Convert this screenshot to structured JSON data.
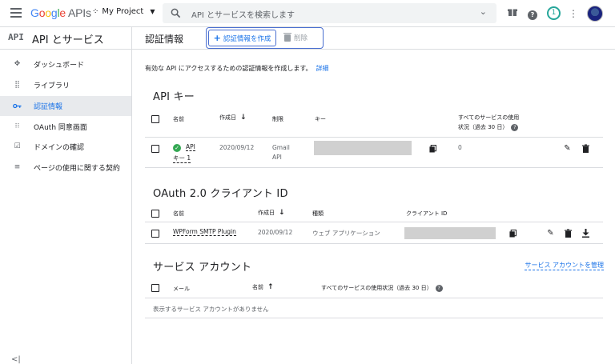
{
  "header": {
    "logo": [
      "G",
      "o",
      "o",
      "g",
      "l",
      "e"
    ],
    "logo_suffix": "APIs",
    "project_name": "My Project",
    "search_placeholder": "API とサービスを検索します",
    "notification_count": "1"
  },
  "sidebar": {
    "section_badge": "API",
    "title": "API とサービス",
    "items": [
      {
        "label": "ダッシュボード",
        "icon": "dashboard-icon"
      },
      {
        "label": "ライブラリ",
        "icon": "library-icon"
      },
      {
        "label": "認証情報",
        "icon": "key-icon",
        "active": true
      },
      {
        "label": "OAuth 同意画面",
        "icon": "oauth-icon"
      },
      {
        "label": "ドメインの確認",
        "icon": "domain-check-icon"
      },
      {
        "label": "ページの使用に関する契約",
        "icon": "settings-list-icon"
      }
    ],
    "collapse_label": "<|"
  },
  "page": {
    "title": "認証情報",
    "create_button": "認証情報を作成",
    "delete_button": "削除",
    "intro_text": "有効な API にアクセスするための認証情報を作成します。",
    "intro_link": "詳細"
  },
  "api_keys": {
    "title": "API キー",
    "columns": [
      "名前",
      "作成日",
      "制限",
      "キー",
      "すべてのサービスの使用",
      "状況（過去 30 日）"
    ],
    "rows": [
      {
        "name_line1": "API",
        "name_line2": "キー 1",
        "created": "2020/09/12",
        "restriction_line1": "Gmail",
        "restriction_line2": "API",
        "usage": "0"
      }
    ]
  },
  "oauth": {
    "title": "OAuth 2.0 クライアント ID",
    "columns": [
      "名前",
      "作成日",
      "種類",
      "クライアント ID"
    ],
    "rows": [
      {
        "name": "WPForm SMTP Plugin",
        "created": "2020/09/12",
        "type": "ウェブ アプリケーション"
      }
    ]
  },
  "service_accounts": {
    "title": "サービス アカウント",
    "manage_link": "サービス アカウントを管理",
    "columns": [
      "メール",
      "名前",
      "すべてのサービスの使用状況（過去 30 日）"
    ],
    "empty_text": "表示するサービス アカウントがありません"
  },
  "colors": {
    "accent": "#1a73e8",
    "active_bg": "#e8eaed",
    "ok_green": "#34a853"
  }
}
